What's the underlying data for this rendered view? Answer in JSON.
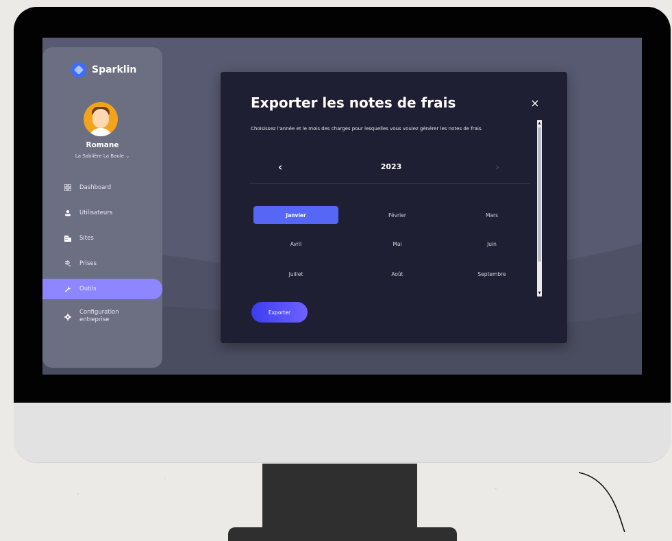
{
  "app": {
    "brand_name": "Sparklin",
    "accent_color": "#8d86ff",
    "primary_button_color": "#5666f5"
  },
  "user": {
    "name": "Romane",
    "site": "La Sablière La Baule ⌄"
  },
  "sidebar": {
    "items": [
      {
        "label": "Dashboard",
        "icon": "grid-icon",
        "active": false
      },
      {
        "label": "Utilisateurs",
        "icon": "user-icon",
        "active": false
      },
      {
        "label": "Sites",
        "icon": "building-icon",
        "active": false
      },
      {
        "label": "Prises",
        "icon": "plug-icon",
        "active": false
      },
      {
        "label": "Outils",
        "icon": "wrench-icon",
        "active": true
      },
      {
        "label": "Configuration entreprise",
        "icon": "gear-icon",
        "active": false
      }
    ]
  },
  "modal": {
    "title": "Exporter les notes de frais",
    "description": "Choisissez l'année et le mois des charges pour lesquelles vous voulez générer les notes de frais.",
    "year": "2023",
    "prev_glyph": "‹",
    "next_glyph": "›",
    "close_glyph": "×",
    "months": [
      "Janvier",
      "Février",
      "Mars",
      "Avril",
      "Mai",
      "Juin",
      "Juillet",
      "Août",
      "Septembre"
    ],
    "selected_month": "Janvier",
    "export_label": "Exporter"
  }
}
